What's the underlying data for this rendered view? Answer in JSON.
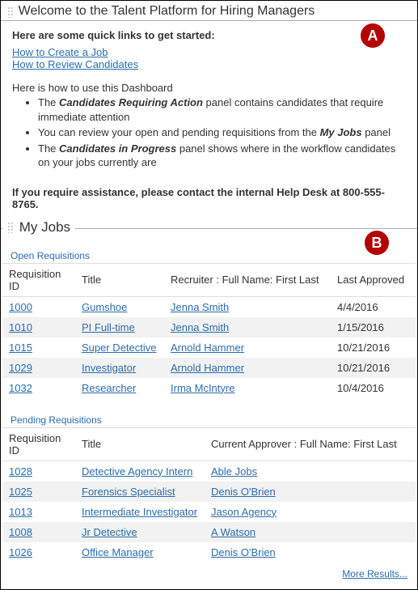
{
  "welcome": {
    "title": "Welcome to the Talent Platform for Hiring Managers",
    "intro": "Here are some quick links to get started:",
    "links": {
      "create_job": "How to Create a Job",
      "review_candidates": "How to Review Candidates"
    },
    "howto_heading": "Here is how to use this Dashboard",
    "bullets": {
      "b1_pre": "The ",
      "b1_em": "Candidates Requiring Action",
      "b1_post": " panel contains candidates that require immediate attention",
      "b2_pre": "You can review your open and pending requisitions from the ",
      "b2_em": "My Jobs",
      "b2_post": " panel",
      "b3_pre": "The ",
      "b3_em": "Candidates in Progress",
      "b3_post": " panel shows where in the workflow candidates on your jobs currently are"
    },
    "help_line": "If you require assistance, please contact the internal Help Desk at 800-555-8765."
  },
  "badges": {
    "a": "A",
    "b": "B"
  },
  "myjobs": {
    "title": "My Jobs",
    "open_label": "Open Requisitions",
    "pending_label": "Pending Requisitions",
    "open_headers": {
      "req": "Requisition ID",
      "title": "Title",
      "recruiter": "Recruiter : Full Name: First Last",
      "last_approved": "Last Approved"
    },
    "pending_headers": {
      "req": "Requisition ID",
      "title": "Title",
      "approver": "Current Approver : Full Name: First Last"
    },
    "open": [
      {
        "req": "1000",
        "title": "Gumshoe",
        "recruiter": "Jenna Smith",
        "last": "4/4/2016"
      },
      {
        "req": "1010",
        "title": "PI Full-time",
        "recruiter": "Jenna Smith",
        "last": "1/15/2016"
      },
      {
        "req": "1015",
        "title": "Super Detective",
        "recruiter": "Arnold Hammer",
        "last": "10/21/2016"
      },
      {
        "req": "1029",
        "title": "Investigator",
        "recruiter": "Arnold Hammer",
        "last": "10/21/2016"
      },
      {
        "req": "1032",
        "title": "Researcher",
        "recruiter": "Irma McIntyre",
        "last": "10/4/2016"
      }
    ],
    "pending": [
      {
        "req": "1028",
        "title": "Detective Agency Intern",
        "approver": "Able Jobs"
      },
      {
        "req": "1025",
        "title": "Forensics Specialist",
        "approver": "Denis O'Brien"
      },
      {
        "req": "1013",
        "title": "Intermediate Investigator",
        "approver": "Jason Agency"
      },
      {
        "req": "1008",
        "title": "Jr Detective",
        "approver": "A Watson"
      },
      {
        "req": "1026",
        "title": "Office Manager",
        "approver": "Denis O'Brien"
      }
    ],
    "more_results": "More Results..."
  }
}
